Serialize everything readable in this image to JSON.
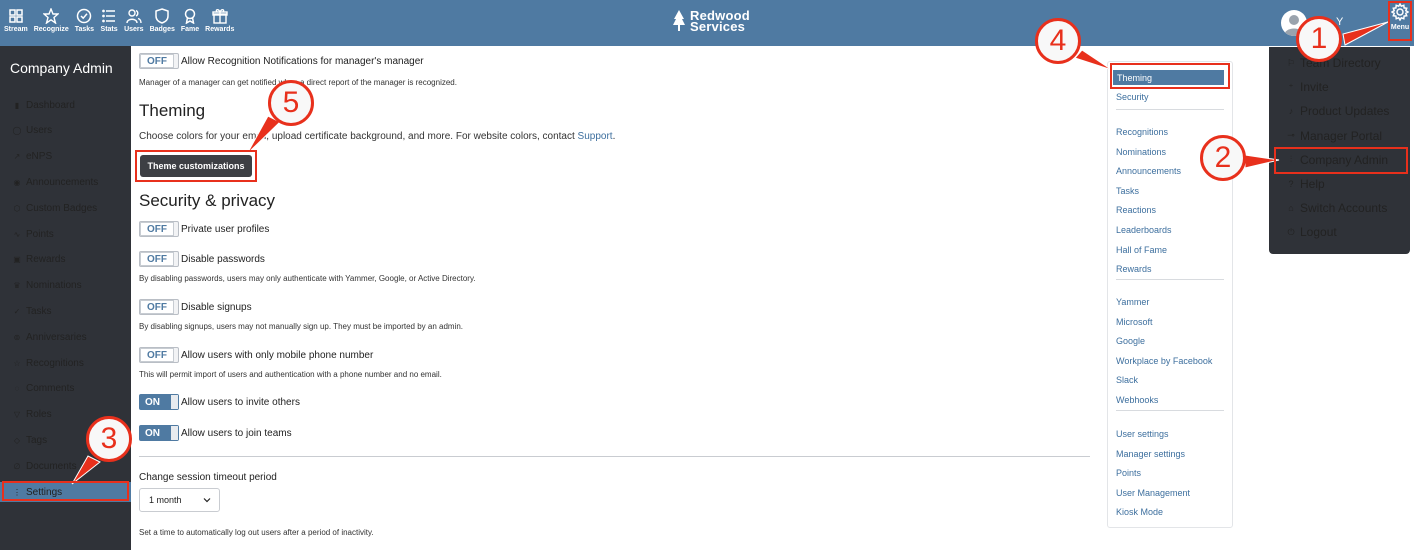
{
  "topnav": [
    {
      "label": "Stream",
      "icon": "grid-icon"
    },
    {
      "label": "Recognize",
      "icon": "star-icon"
    },
    {
      "label": "Tasks",
      "icon": "check-circle-icon"
    },
    {
      "label": "Stats",
      "icon": "list-icon"
    },
    {
      "label": "Users",
      "icon": "users-icon"
    },
    {
      "label": "Badges",
      "icon": "shield-icon"
    },
    {
      "label": "Fame",
      "icon": "award-icon"
    },
    {
      "label": "Rewards",
      "icon": "gift-icon"
    }
  ],
  "brand": {
    "line1": "Redwood",
    "line2": "Services"
  },
  "header": {
    "user_name": "Y",
    "menu_label": "Menu"
  },
  "sidebar": {
    "title": "Company Admin",
    "items": [
      {
        "label": "Dashboard"
      },
      {
        "label": "Users"
      },
      {
        "label": "eNPS"
      },
      {
        "label": "Announcements"
      },
      {
        "label": "Custom Badges"
      },
      {
        "label": "Points"
      },
      {
        "label": "Rewards"
      },
      {
        "label": "Nominations"
      },
      {
        "label": "Tasks"
      },
      {
        "label": "Anniversaries"
      },
      {
        "label": "Recognitions"
      },
      {
        "label": "Comments"
      },
      {
        "label": "Roles"
      },
      {
        "label": "Tags"
      },
      {
        "label": "Documents"
      },
      {
        "label": "Settings"
      }
    ]
  },
  "main": {
    "manager_toggle": {
      "state": "OFF",
      "label": "Allow Recognition Notifications for manager's manager",
      "help": "Manager of a manager can get notified when a direct report of the manager is recognized."
    },
    "theming": {
      "heading": "Theming",
      "desc_before": "Choose colors for your email, upload certificate background, and more. For website colors, contact ",
      "desc_link": "Support",
      "desc_after": ".",
      "button": "Theme customizations"
    },
    "security": {
      "heading": "Security & privacy",
      "options": [
        {
          "state": "OFF",
          "label": "Private user profiles",
          "help": ""
        },
        {
          "state": "OFF",
          "label": "Disable passwords",
          "help": "By disabling passwords, users may only authenticate with Yammer, Google, or Active Directory."
        },
        {
          "state": "OFF",
          "label": "Disable signups",
          "help": "By disabling signups, users may not manually sign up. They must be imported by an admin."
        },
        {
          "state": "OFF",
          "label": "Allow users with only mobile phone number",
          "help": "This will permit import of users and authentication with a phone number and no email."
        },
        {
          "state": "ON",
          "label": "Allow users to invite others",
          "help": ""
        },
        {
          "state": "ON",
          "label": "Allow users to join teams",
          "help": ""
        }
      ]
    },
    "session": {
      "label": "Change session timeout period",
      "value": "1 month",
      "help": "Set a time to automatically log out users after a period of inactivity."
    }
  },
  "right_nav": {
    "group1": [
      "Theming",
      "Security"
    ],
    "group2": [
      "Recognitions",
      "Nominations",
      "Announcements",
      "Tasks",
      "Reactions",
      "Leaderboards",
      "Hall of Fame",
      "Rewards"
    ],
    "group3": [
      "Yammer",
      "Microsoft",
      "Google",
      "Workplace by Facebook",
      "Slack",
      "Webhooks"
    ],
    "group4": [
      "User settings",
      "Manager settings",
      "Points",
      "User Management",
      "Kiosk Mode"
    ]
  },
  "dropdown": [
    {
      "label": "Team Directory",
      "icon": "flag-icon"
    },
    {
      "label": "Invite",
      "icon": "user-plus-icon"
    },
    {
      "label": "Product Updates",
      "icon": "bell-icon"
    },
    {
      "label": "Manager Portal",
      "icon": "commit-icon"
    },
    {
      "label": "Company Admin",
      "icon": "sliders-icon"
    },
    {
      "label": "Help",
      "icon": "question-icon"
    },
    {
      "label": "Switch Accounts",
      "icon": "home-icon"
    },
    {
      "label": "Logout",
      "icon": "power-icon"
    }
  ],
  "callouts": [
    "1",
    "2",
    "3",
    "4",
    "5"
  ],
  "colors": {
    "topbar": "#4f7aa2",
    "sidebar": "#2f3238",
    "accent": "#e8301c",
    "link": "#3d6f9e"
  }
}
